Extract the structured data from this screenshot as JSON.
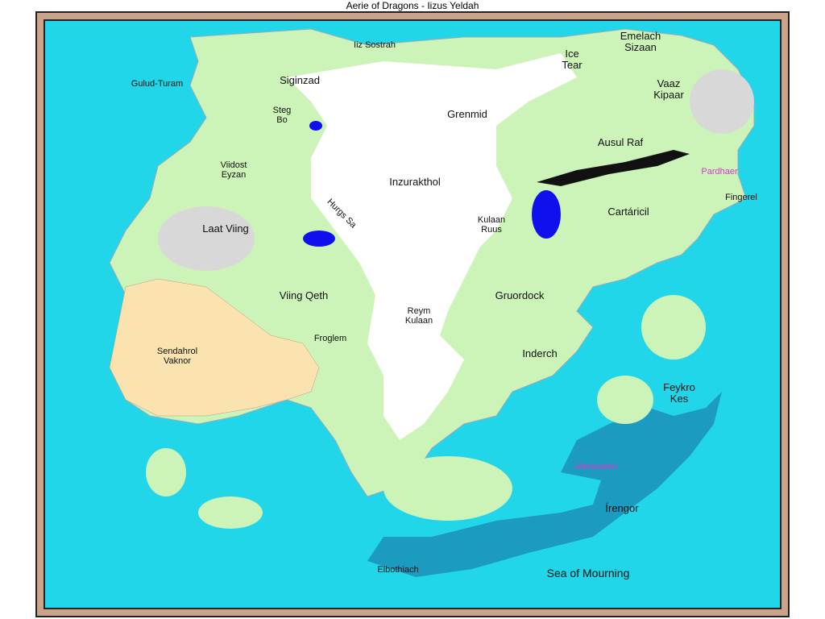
{
  "title": "Aerie of Dragons - Iizus Yeldah",
  "colors": {
    "sea": "#22d6ea",
    "deep_sea": "#1c9bc0",
    "land": "#cdf4b8",
    "snow": "#ffffff",
    "desert": "#fbe3b0",
    "rock": "#d8d8d8",
    "frame": "#c9a48a",
    "lake": "#1010ee",
    "capital_label": "#d03cd0"
  },
  "labels": {
    "iiz_sostrah": "Iiz Sostrah",
    "ice_tear": "Ice\nTear",
    "emelach_sizaan": "Emelach\nSizaan",
    "gulud_turam": "Gulud-Turam",
    "siginzad": "Siginzad",
    "vaaz_kipaar": "Vaaz\nKipaar",
    "steg_bo": "Steg\nBo",
    "grenmid": "Grenmid",
    "ausul_raf": "Ausul Raf",
    "viidost_eyzan": "Viidost\nEyzan",
    "inzurakthol": "Inzurakthol",
    "pardhaer": "Pardhaer",
    "fingerel": "Fingerel",
    "hurgs_sa": "Hurgs Sa",
    "kulaan_ruus": "Kulaan\nRuus",
    "cartaricil": "Cartáricil",
    "laat_viing": "Laat Viing",
    "viing_qeth": "Viing Qeth",
    "gruordock": "Gruordock",
    "reym_kulaan": "Reym\nKulaan",
    "froglem": "Froglem",
    "sendahrol_vaknor": "Sendahrol\nVaknor",
    "inderch": "Inderch",
    "feykro_kes": "Feykro\nKes",
    "merenwen": "Merenwen",
    "irengor": "Írengor",
    "sea_of_mourning": "Sea of Mourning",
    "elbothiach": "Elbothiach"
  }
}
